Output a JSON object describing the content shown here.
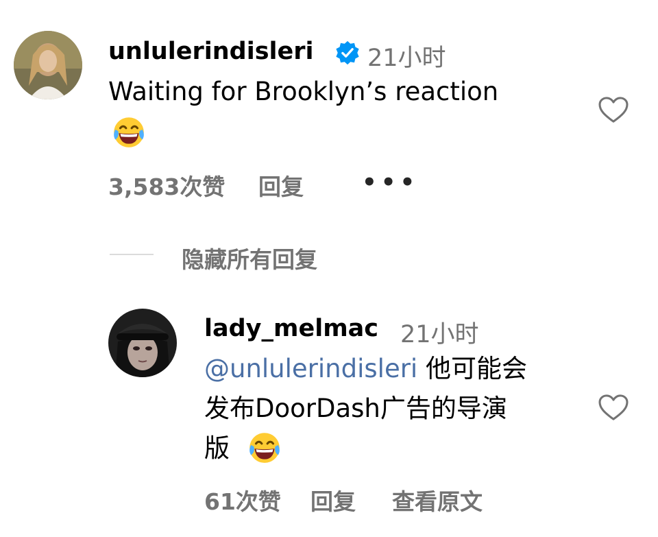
{
  "comment": {
    "username": "unlulerindisleri",
    "verified_icon": "verified-badge-icon",
    "time": "21小时",
    "text": "Waiting for Brooklyn’s reaction",
    "emoji": "😂",
    "likes": "3,583次赞",
    "reply_label": "回复",
    "more_label": "•••",
    "heart_icon": "heart-outline-icon"
  },
  "replies_toggle": {
    "label": "隐藏所有回复"
  },
  "reply": {
    "username": "lady_melmac",
    "time": "21小时",
    "mention": "@unlulerindisleri",
    "text_line1": "他可能会",
    "text_line2": "发布DoorDash广告的导演",
    "text_line3": "版",
    "emoji": "😂",
    "likes": "61次赞",
    "reply_label": "回复",
    "translate_label": "查看原文",
    "heart_icon": "heart-outline-icon"
  },
  "colors": {
    "secondary_text": "#737373",
    "mention": "#4a6fa5",
    "verified": "#0095f6"
  }
}
